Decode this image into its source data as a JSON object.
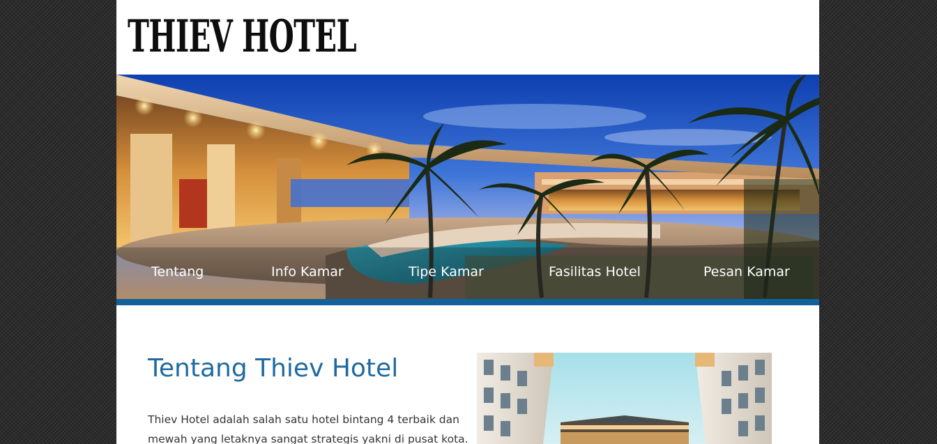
{
  "header": {
    "logo_text": "THIEV HOTEL"
  },
  "nav": {
    "items": [
      {
        "label": "Tentang"
      },
      {
        "label": "Info Kamar"
      },
      {
        "label": "Tipe Kamar"
      },
      {
        "label": "Fasilitas Hotel"
      },
      {
        "label": "Pesan Kamar"
      }
    ]
  },
  "about": {
    "title": "Tentang Thiev Hotel",
    "paragraph": "Thiev Hotel adalah salah satu hotel bintang 4 terbaik dan mewah yang letaknya sangat strategis yakni di pusat kota."
  },
  "colors": {
    "accent_bar": "#13619a",
    "title_blue": "#1f6aa0",
    "page_bg": "#2e2e2e"
  }
}
